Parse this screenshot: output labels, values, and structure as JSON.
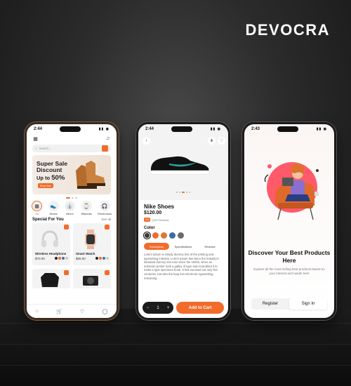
{
  "brand": "DEVOCRA",
  "phone1": {
    "time": "2:44",
    "search_placeholder": "Search...",
    "banner": {
      "line1": "Super Sale Discount",
      "line2": "Up to",
      "percent": "50%",
      "button": "Shop Now"
    },
    "categories": [
      {
        "label": "All",
        "icon": "▦"
      },
      {
        "label": "Shoes",
        "icon": "👟"
      },
      {
        "label": "Men's",
        "icon": "👔"
      },
      {
        "label": "Watches",
        "icon": "⌚"
      },
      {
        "label": "Electronics",
        "icon": "🎧"
      }
    ],
    "section_title": "Special For You",
    "see_all": "See all",
    "products": [
      {
        "name": "Wireless Headphone",
        "price": "$70.00",
        "swatches": [
          "#222",
          "#f26b2b",
          "#4a6fa5",
          "#c9c9c9"
        ]
      },
      {
        "name": "Smart Watch",
        "price": "$55.00",
        "swatches": [
          "#222",
          "#f26b2b",
          "#4a6fa5",
          "#c9c9c9"
        ]
      }
    ],
    "tab_icons": [
      "home-icon",
      "cart-icon",
      "heart-icon",
      "profile-icon"
    ]
  },
  "phone2": {
    "time": "2:44",
    "title": "Nike Shoes",
    "price": "$120.00",
    "rating": "4.8",
    "reviews": "(320 Review)",
    "color_label": "Color",
    "colors": [
      "#3a3a3a",
      "#f26b2b",
      "#e0762f",
      "#3b6aa8",
      "#6b6b6b"
    ],
    "tabs": [
      "Description",
      "Specifications",
      "Reviews"
    ],
    "description": "Lorem Ipsum is simply dummy text of the printing and typesetting industry. Lorem Ipsum has been the industry's standard dummy text ever since the 1500s, when an unknown printer took a galley of type and scrambled it to make a type specimen book. It has survived not only five centuries, but also the leap into electronic typesetting, remaining",
    "quantity": "1",
    "add_to_cart": "Add to Cart"
  },
  "phone3": {
    "time": "2:43",
    "heading": "Discover Your Best Products Here",
    "subtext": "Explore all the most selling best products based on your interest and needs here",
    "register": "Register",
    "sign_in": "Sign In"
  }
}
